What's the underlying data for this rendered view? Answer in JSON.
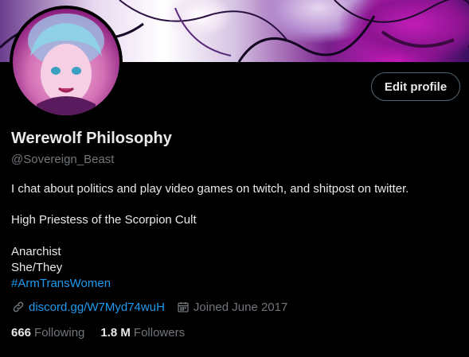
{
  "profile": {
    "display_name": "Werewolf Philosophy",
    "handle": "@Sovereign_Beast",
    "edit_button_label": "Edit profile",
    "bio": [
      "I chat about politics and play video games on twitch, and shitpost on twitter.",
      "High Priestess of the Scorpion Cult",
      "Anarchist",
      "She/They"
    ],
    "hashtag": "#ArmTransWomen",
    "website": "discord.gg/W7Myd74wuH",
    "joined": "Joined June 2017",
    "following_count": "666",
    "following_label": "Following",
    "followers_count": "1.8 M",
    "followers_label": "Followers"
  },
  "icons": {
    "link": "link-icon",
    "calendar": "calendar-icon"
  },
  "colors": {
    "background": "#000000",
    "text_primary": "#e7e9ea",
    "text_secondary": "#71767b",
    "link": "#1d9bf0",
    "button_border": "#536471",
    "banner_accent": "#c21db8"
  }
}
